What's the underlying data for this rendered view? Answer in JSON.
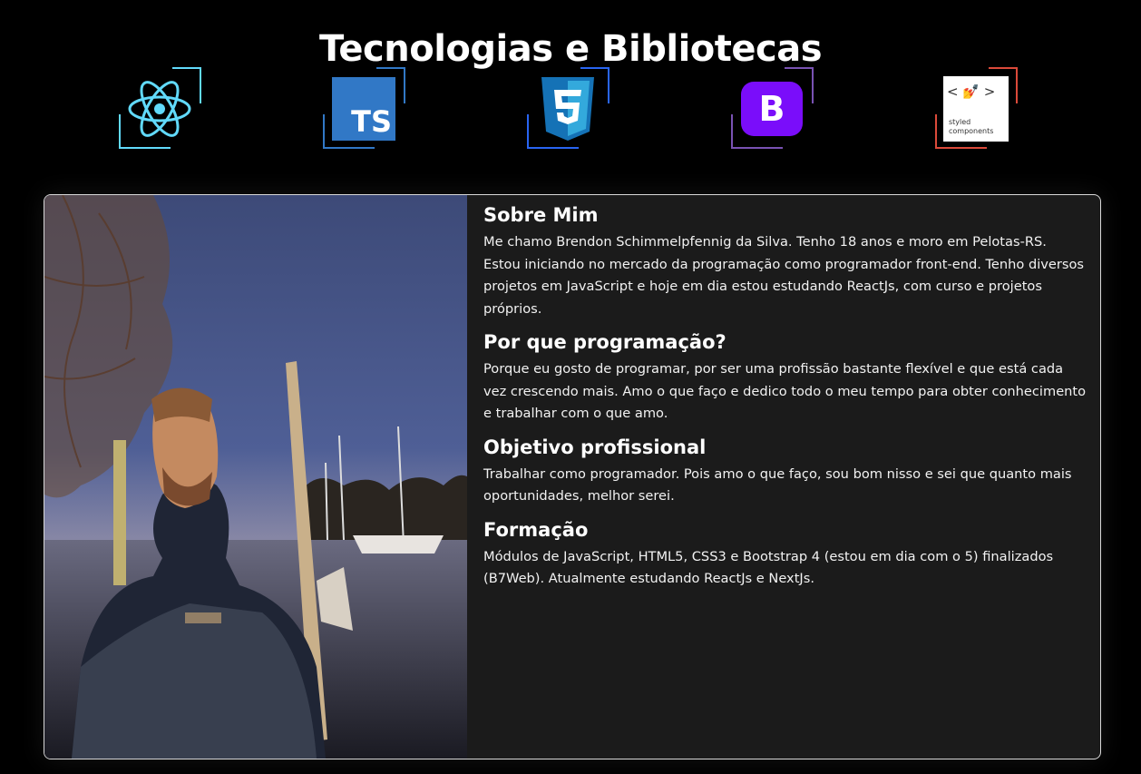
{
  "page": {
    "title": "Tecnologias e Bibliotecas"
  },
  "technologies": [
    {
      "name": "React",
      "icon": "react-icon",
      "accent": "#61dafb"
    },
    {
      "name": "TypeScript",
      "icon": "typescript-icon",
      "accent": "#3178c6",
      "badge": "TS"
    },
    {
      "name": "CSS3",
      "icon": "css3-icon",
      "accent": "#2965f1",
      "badge": "3"
    },
    {
      "name": "Bootstrap",
      "icon": "bootstrap-icon",
      "accent": "#7952b3",
      "badge": "B"
    },
    {
      "name": "styled-components",
      "icon": "styled-components-icon",
      "accent": "#db4a3a",
      "line1": "styled",
      "line2": "components",
      "code": "< 💅 >"
    }
  ],
  "about": {
    "photo_icon": "profile-photo",
    "sections": [
      {
        "heading": "Sobre Mim",
        "text": "Me chamo Brendon Schimmelpfennig da Silva. Tenho 18 anos e moro em Pelotas-RS. Estou iniciando no mercado da programação como programador front-end. Tenho diversos projetos em JavaScript e hoje em dia estou estudando ReactJs, com curso e projetos próprios."
      },
      {
        "heading": "Por que programação?",
        "text": "Porque eu gosto de programar, por ser uma profissão bastante flexível e que está cada vez crescendo mais. Amo o que faço e dedico todo o meu tempo para obter conhecimento e trabalhar com o que amo."
      },
      {
        "heading": "Objetivo profissional",
        "text": "Trabalhar como programador. Pois amo o que faço, sou bom nisso e sei que quanto mais oportunidades, melhor serei."
      },
      {
        "heading": "Formação",
        "text": "Módulos de JavaScript, HTML5, CSS3 e Bootstrap 4 (estou em dia com o 5) finalizados (B7Web). Atualmente estudando ReactJs e NextJs."
      }
    ]
  }
}
